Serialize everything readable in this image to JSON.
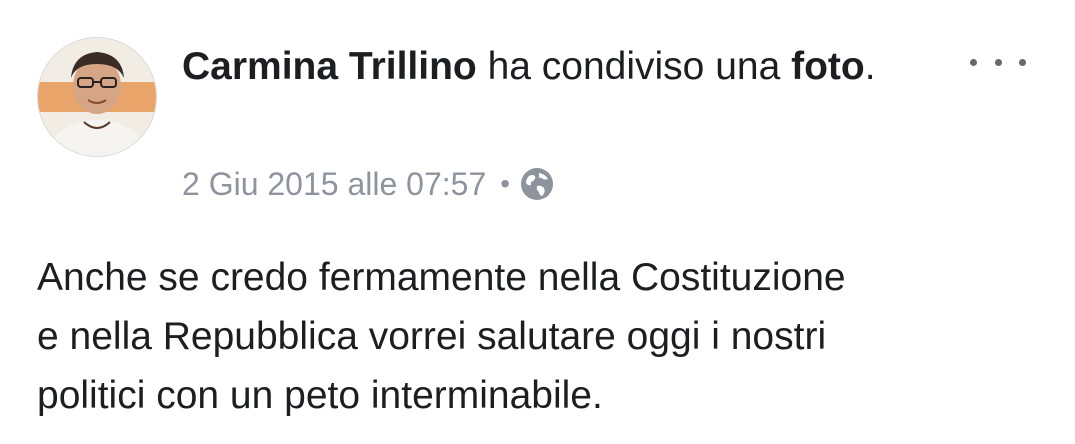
{
  "post": {
    "author_name": "Carmina Trillino",
    "action_text": " ha condiviso una ",
    "action_object": "foto",
    "action_end": ".",
    "timestamp": "2 Giu 2015 alle 07:57",
    "separator": "•",
    "privacy_icon": "globe-icon",
    "more_icon": "more-options-icon",
    "body": "Anche se credo fermamente nella Costituzione\ne nella Repubblica vorrei salutare oggi i nostri\npolitici con un peto interminabile."
  },
  "colors": {
    "text": "#1c1e21",
    "meta": "#8d949e",
    "icon": "#65676b"
  }
}
